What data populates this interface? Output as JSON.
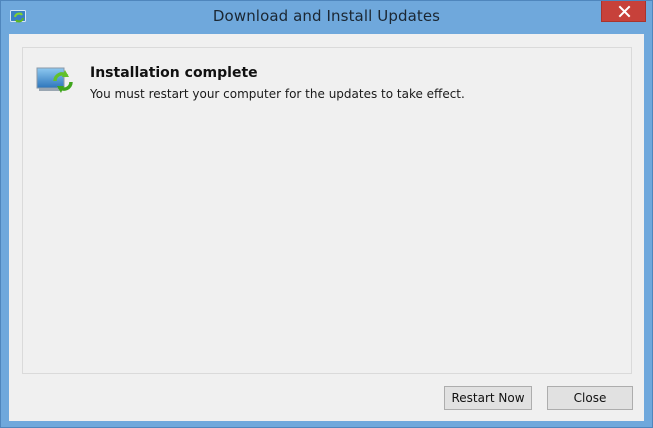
{
  "window": {
    "title": "Download and Install Updates",
    "icon": "windows-update-icon",
    "close_icon": "close-icon"
  },
  "status": {
    "icon": "windows-update-icon",
    "heading": "Installation complete",
    "message": "You must restart your computer for the updates to take effect."
  },
  "buttons": {
    "restart_label": "Restart Now",
    "close_label": "Close"
  },
  "colors": {
    "title_bar": "#6fa8dc",
    "close_button": "#c7413a",
    "client_background": "#f0f0f0"
  }
}
